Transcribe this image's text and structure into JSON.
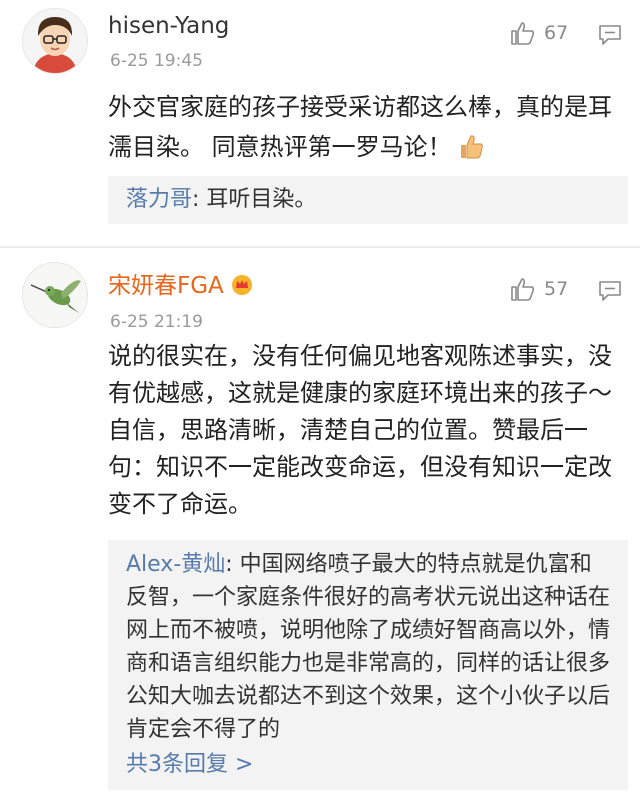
{
  "comments": [
    {
      "username": "hisen-Yang",
      "time": "6-25 19:45",
      "likes": "67",
      "body": "外交官家庭的孩子接受采访都这么棒，真的是耳濡目染。 同意热评第一罗马论！",
      "reply": {
        "username": "落力哥",
        "text": ": 耳听目染。"
      }
    },
    {
      "username": "宋妍春FGA",
      "time": "6-25 21:19",
      "likes": "57",
      "body": "说的很实在，没有任何偏见地客观陈述事实，没有优越感，这就是健康的家庭环境出来的孩子～自信，思路清晰，清楚自己的位置。赞最后一句：知识不一定能改变命运，但没有知识一定改变不了命运。",
      "reply": {
        "username": "Alex-黄灿",
        "text": ": 中国网络喷子最大的特点就是仇富和反智，一个家庭条件很好的高考状元说出这种话在网上而不被喷，说明他除了成绩好智商高以外，情商和语言组织能力也是非常高的，同样的话让很多公知大咖去说都达不到这个效果，这个小伙子以后肯定会不得了的",
        "more": "共3条回复 >"
      }
    }
  ],
  "colors": {
    "username_vip": "#e8661b",
    "link": "#567bab",
    "quote_bg": "#f3f3f3"
  }
}
